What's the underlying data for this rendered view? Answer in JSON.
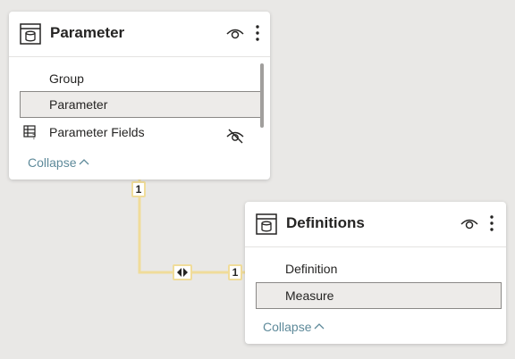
{
  "colors": {
    "canvas": "#e9e8e6",
    "card": "#ffffff",
    "relationship_line": "#f0dc9a",
    "selected_row": "#edebe9",
    "collapse_link": "#5e8a9a"
  },
  "tables": [
    {
      "title": "Parameter",
      "icons": [
        "table-icon",
        "eye-icon",
        "more-vertical-icon"
      ],
      "fields": [
        {
          "name": "Group",
          "icon": ""
        },
        {
          "name": "Parameter",
          "icon": "",
          "selected": true
        },
        {
          "name": "Parameter Fields",
          "icon": "field-parameter-icon",
          "status_icon": "eye-hidden-icon"
        }
      ],
      "collapse_label": "Collapse"
    },
    {
      "title": "Definitions",
      "icons": [
        "table-icon",
        "eye-icon",
        "more-vertical-icon"
      ],
      "fields": [
        {
          "name": "Definition",
          "icon": ""
        },
        {
          "name": "Measure",
          "icon": "",
          "selected": true
        }
      ],
      "collapse_label": "Collapse"
    }
  ],
  "relationship": {
    "from_cardinality": "1",
    "to_cardinality": "1",
    "cross_filter": "both"
  }
}
